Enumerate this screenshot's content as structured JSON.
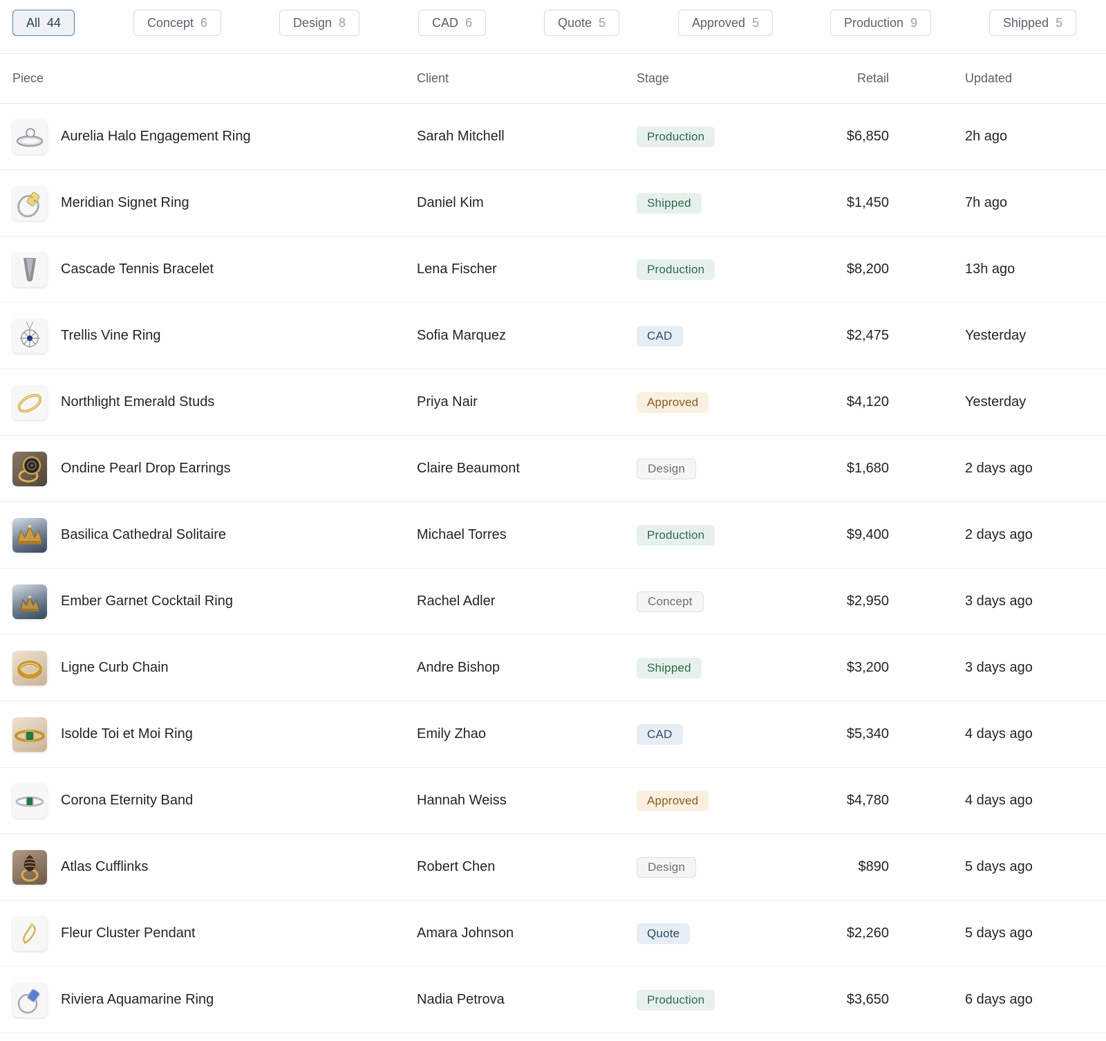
{
  "filters": [
    {
      "label": "All",
      "count": "44",
      "active": true
    },
    {
      "label": "Concept",
      "count": "6"
    },
    {
      "label": "Design",
      "count": "8"
    },
    {
      "label": "CAD",
      "count": "6"
    },
    {
      "label": "Quote",
      "count": "5"
    },
    {
      "label": "Approved",
      "count": "5"
    },
    {
      "label": "Production",
      "count": "9"
    },
    {
      "label": "Shipped",
      "count": "5"
    }
  ],
  "table": {
    "headers": {
      "piece": "Piece",
      "client": "Client",
      "stage": "Stage",
      "retail": "Retail",
      "updated": "Updated"
    },
    "rows": [
      {
        "piece": "Aurelia Halo Engagement Ring",
        "client": "Sarah Mitchell",
        "stage": "Production",
        "retail": "$6,850",
        "updated": "2h ago",
        "thumb": "ring-icon"
      },
      {
        "piece": "Meridian Signet Ring",
        "client": "Daniel Kim",
        "stage": "Shipped",
        "retail": "$1,450",
        "updated": "7h ago",
        "thumb": "ring-icon"
      },
      {
        "piece": "Cascade Tennis Bracelet",
        "client": "Lena Fischer",
        "stage": "Production",
        "retail": "$8,200",
        "updated": "13h ago",
        "thumb": "bracelet-icon"
      },
      {
        "piece": "Trellis Vine Ring",
        "client": "Sofia Marquez",
        "stage": "CAD",
        "retail": "$2,475",
        "updated": "Yesterday",
        "thumb": "pendant-icon"
      },
      {
        "piece": "Northlight Emerald Studs",
        "client": "Priya Nair",
        "stage": "Approved",
        "retail": "$4,120",
        "updated": "Yesterday",
        "thumb": "band-icon"
      },
      {
        "piece": "Ondine Pearl Drop Earrings",
        "client": "Claire Beaumont",
        "stage": "Design",
        "retail": "$1,680",
        "updated": "2 days ago",
        "thumb": "signet-icon"
      },
      {
        "piece": "Basilica Cathedral Solitaire",
        "client": "Michael Torres",
        "stage": "Production",
        "retail": "$9,400",
        "updated": "2 days ago",
        "thumb": "crown-icon"
      },
      {
        "piece": "Ember Garnet Cocktail Ring",
        "client": "Rachel Adler",
        "stage": "Concept",
        "retail": "$2,950",
        "updated": "3 days ago",
        "thumb": "crown-icon"
      },
      {
        "piece": "Ligne Curb Chain",
        "client": "Andre Bishop",
        "stage": "Shipped",
        "retail": "$3,200",
        "updated": "3 days ago",
        "thumb": "band-icon"
      },
      {
        "piece": "Isolde Toi et Moi Ring",
        "client": "Emily Zhao",
        "stage": "CAD",
        "retail": "$5,340",
        "updated": "4 days ago",
        "thumb": "emerald-ring-icon"
      },
      {
        "piece": "Corona Eternity Band",
        "client": "Hannah Weiss",
        "stage": "Approved",
        "retail": "$4,780",
        "updated": "4 days ago",
        "thumb": "emerald-ring-icon"
      },
      {
        "piece": "Atlas Cufflinks",
        "client": "Robert Chen",
        "stage": "Design",
        "retail": "$890",
        "updated": "5 days ago",
        "thumb": "cluster-ring-icon"
      },
      {
        "piece": "Fleur Cluster Pendant",
        "client": "Amara Johnson",
        "stage": "Quote",
        "retail": "$2,260",
        "updated": "5 days ago",
        "thumb": "earring-icon"
      },
      {
        "piece": "Riviera Aquamarine Ring",
        "client": "Nadia Petrova",
        "stage": "Production",
        "retail": "$3,650",
        "updated": "6 days ago",
        "thumb": "aquamarine-ring-icon"
      }
    ]
  }
}
